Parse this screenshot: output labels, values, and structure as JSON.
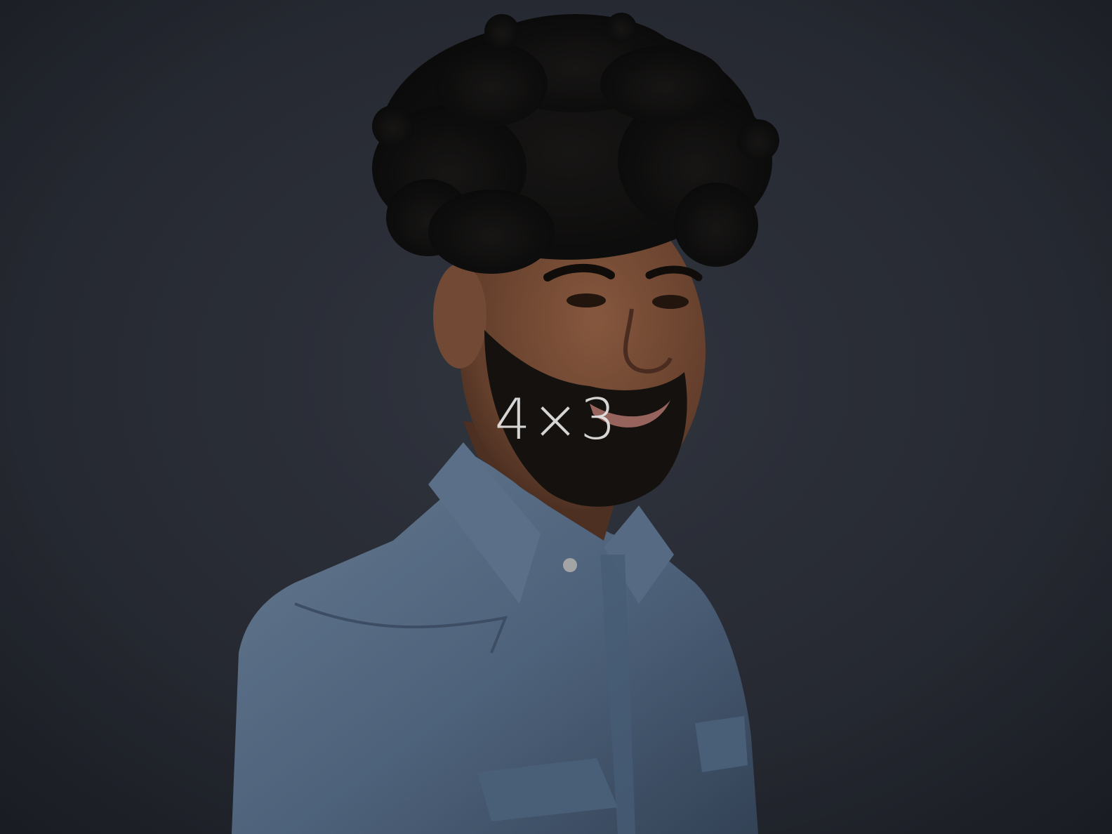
{
  "overlay_label": "4×3",
  "colors": {
    "background": "#3a3f4b",
    "background_edge": "#1f222a",
    "shirt": "#6d86a3",
    "skin": "#8a5a40",
    "hair": "#141414",
    "label_text": "#e6e6e6"
  }
}
